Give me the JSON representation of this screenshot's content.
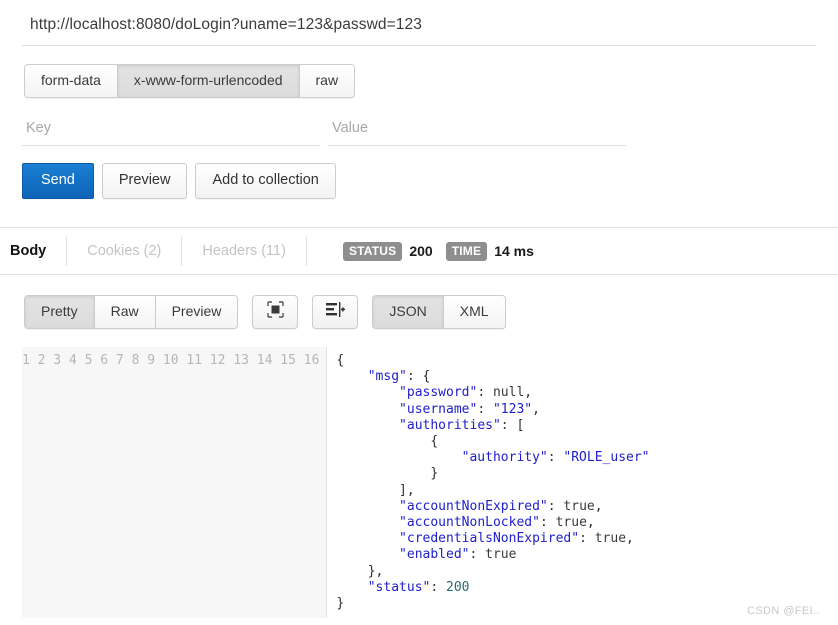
{
  "request": {
    "url": "http://localhost:8080/doLogin?uname=123&passwd=123",
    "body_types": [
      {
        "label": "form-data",
        "active": false
      },
      {
        "label": "x-www-form-urlencoded",
        "active": true
      },
      {
        "label": "raw",
        "active": false
      }
    ],
    "key_placeholder": "Key",
    "value_placeholder": "Value",
    "key_value": "",
    "value_value": "",
    "actions": {
      "send": "Send",
      "preview": "Preview",
      "add_to_collection": "Add to collection"
    }
  },
  "response": {
    "tabs": [
      {
        "label": "Body",
        "active": true
      },
      {
        "label": "Cookies (2)",
        "active": false
      },
      {
        "label": "Headers (11)",
        "active": false
      }
    ],
    "status_chip": "STATUS",
    "status_value": "200",
    "time_chip": "TIME",
    "time_value": "14 ms",
    "view_modes": [
      {
        "label": "Pretty",
        "active": true
      },
      {
        "label": "Raw",
        "active": false
      },
      {
        "label": "Preview",
        "active": false
      }
    ],
    "icon_buttons": [
      {
        "name": "fullscreen-icon",
        "title": "Fullscreen"
      },
      {
        "name": "wrap-lines-icon",
        "title": "Wrap lines"
      }
    ],
    "languages": [
      {
        "label": "JSON",
        "active": true
      },
      {
        "label": "XML",
        "active": false
      }
    ],
    "line_numbers": [
      "1",
      "2",
      "3",
      "4",
      "5",
      "6",
      "7",
      "8",
      "9",
      "10",
      "11",
      "12",
      "13",
      "14",
      "15",
      "16"
    ],
    "body_text": "{\n    \"msg\": {\n        \"password\": null,\n        \"username\": \"123\",\n        \"authorities\": [\n            {\n                \"authority\": \"ROLE_user\"\n            }\n        ],\n        \"accountNonExpired\": true,\n        \"accountNonLocked\": true,\n        \"credentialsNonExpired\": true,\n        \"enabled\": true\n    },\n    \"status\": 200\n}",
    "body_json": {
      "msg": {
        "password": null,
        "username": "123",
        "authorities": [
          {
            "authority": "ROLE_user"
          }
        ],
        "accountNonExpired": true,
        "accountNonLocked": true,
        "credentialsNonExpired": true,
        "enabled": true
      },
      "status": 200
    }
  },
  "watermark": "CSDN @FEI..",
  "colors": {
    "primary_button": "#0d63b5",
    "chip_gray": "#8e8e8e",
    "json_key": "#2020cc",
    "json_number": "#2b6c6c"
  }
}
